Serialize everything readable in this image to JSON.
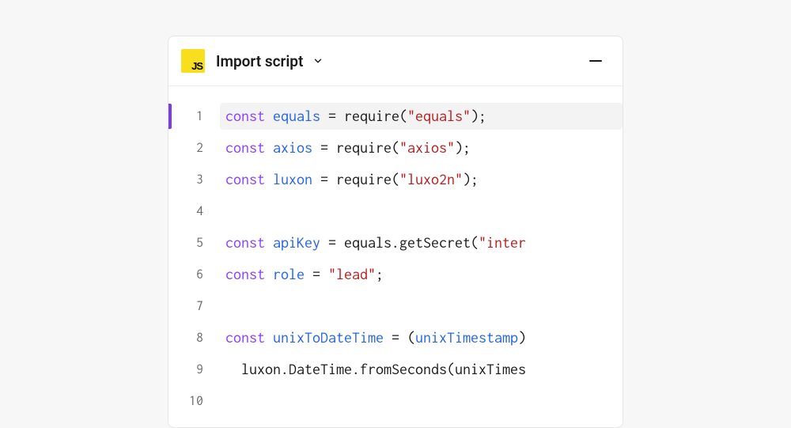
{
  "header": {
    "badge_text": "JS",
    "title": "Import script"
  },
  "code": {
    "lines": [
      {
        "num": "1",
        "highlighted": true,
        "gutter_marker": true,
        "tokens": [
          {
            "t": "const",
            "c": "keyword"
          },
          {
            "t": " ",
            "c": "default"
          },
          {
            "t": "equals",
            "c": "variable"
          },
          {
            "t": " = require(",
            "c": "default"
          },
          {
            "t": "\"equals\"",
            "c": "string"
          },
          {
            "t": ");",
            "c": "default"
          }
        ]
      },
      {
        "num": "2",
        "tokens": [
          {
            "t": "const",
            "c": "keyword"
          },
          {
            "t": " ",
            "c": "default"
          },
          {
            "t": "axios",
            "c": "variable"
          },
          {
            "t": " = require(",
            "c": "default"
          },
          {
            "t": "\"axios\"",
            "c": "string"
          },
          {
            "t": ");",
            "c": "default"
          }
        ]
      },
      {
        "num": "3",
        "tokens": [
          {
            "t": "const",
            "c": "keyword"
          },
          {
            "t": " ",
            "c": "default"
          },
          {
            "t": "luxon",
            "c": "variable"
          },
          {
            "t": " = require(",
            "c": "default"
          },
          {
            "t": "\"luxo2n\"",
            "c": "string"
          },
          {
            "t": ");",
            "c": "default"
          }
        ]
      },
      {
        "num": "4",
        "tokens": []
      },
      {
        "num": "5",
        "tokens": [
          {
            "t": "const",
            "c": "keyword"
          },
          {
            "t": " ",
            "c": "default"
          },
          {
            "t": "apiKey",
            "c": "variable"
          },
          {
            "t": " = equals.getSecret(",
            "c": "default"
          },
          {
            "t": "\"inter",
            "c": "string"
          }
        ]
      },
      {
        "num": "6",
        "tokens": [
          {
            "t": "const",
            "c": "keyword"
          },
          {
            "t": " ",
            "c": "default"
          },
          {
            "t": "role",
            "c": "variable"
          },
          {
            "t": " = ",
            "c": "default"
          },
          {
            "t": "\"lead\"",
            "c": "string"
          },
          {
            "t": ";",
            "c": "default"
          }
        ]
      },
      {
        "num": "7",
        "tokens": []
      },
      {
        "num": "8",
        "tokens": [
          {
            "t": "const",
            "c": "keyword"
          },
          {
            "t": " ",
            "c": "default"
          },
          {
            "t": "unixToDateTime",
            "c": "variable"
          },
          {
            "t": " = (",
            "c": "default"
          },
          {
            "t": "unixTimestamp",
            "c": "variable"
          },
          {
            "t": ")",
            "c": "default"
          }
        ]
      },
      {
        "num": "9",
        "tokens": [
          {
            "t": "  luxon.DateTime.fromSeconds(unixTimes",
            "c": "default"
          }
        ]
      },
      {
        "num": "10",
        "tokens": []
      }
    ]
  }
}
